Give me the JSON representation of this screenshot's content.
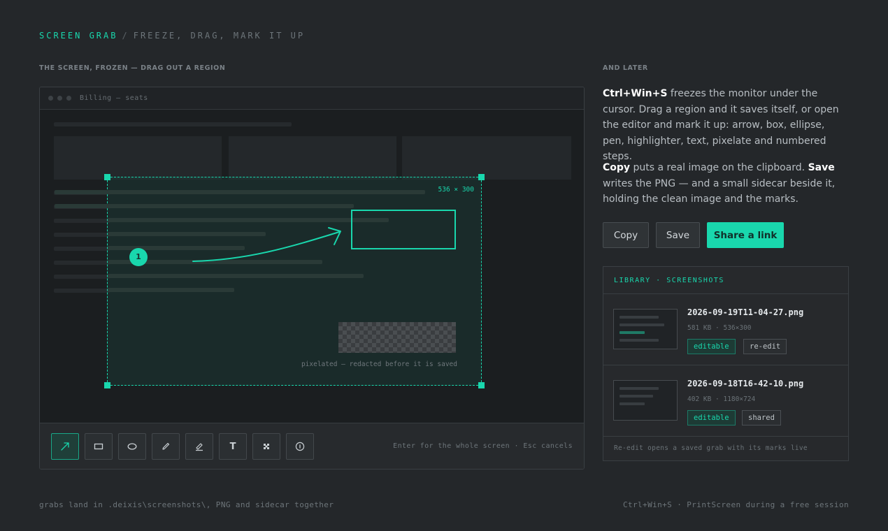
{
  "header": {
    "brand": "SCREEN GRAB",
    "separator": "/",
    "tagline": "FREEZE, DRAG, MARK IT UP"
  },
  "left": {
    "section_label": "THE SCREEN, FROZEN — DRAG OUT A REGION",
    "window_title": "Billing — seats",
    "selection_dims": "536 × 300",
    "step_number": "1",
    "pixelate_label": "pixelated — redacted before it is saved",
    "tools": [
      {
        "name": "arrow-tool",
        "icon": "arrow-icon",
        "active": true
      },
      {
        "name": "box-tool",
        "icon": "rectangle-icon",
        "active": false
      },
      {
        "name": "ellipse-tool",
        "icon": "ellipse-icon",
        "active": false
      },
      {
        "name": "pen-tool",
        "icon": "pen-icon",
        "active": false
      },
      {
        "name": "highlighter-tool",
        "icon": "highlighter-icon",
        "active": false
      },
      {
        "name": "text-tool",
        "icon": "text-icon",
        "label": "T",
        "active": false
      },
      {
        "name": "pixelate-tool",
        "icon": "pixelate-icon",
        "active": false
      },
      {
        "name": "step-tool",
        "icon": "numbered-step-icon",
        "active": false
      }
    ],
    "toolbar_hint": "Enter for the whole screen · Esc cancels"
  },
  "right": {
    "section_label": "AND LATER",
    "para1": {
      "strong": "Ctrl+Win+S",
      "text": " freezes the monitor under the cursor. Drag a region and it saves itself, or open the editor and mark it up: arrow, box, ellipse, pen, highlighter, text, pixelate and numbered steps."
    },
    "para2": {
      "strong1": "Copy",
      "text1": " puts a real image on the clipboard. ",
      "strong2": "Save",
      "text2": " writes the PNG — and a small sidecar beside it, holding the clean image and the marks."
    },
    "buttons": {
      "copy": "Copy",
      "save": "Save",
      "share": "Share a link"
    },
    "library": {
      "title": "LIBRARY · SCREENSHOTS",
      "items": [
        {
          "filename": "2026-09-19T11-04-27.png",
          "meta": "581 KB · 536×300",
          "tag1": "editable",
          "tag2": "re-edit"
        },
        {
          "filename": "2026-09-18T16-42-10.png",
          "meta": "402 KB · 1180×724",
          "tag1": "editable",
          "tag2": "shared"
        }
      ],
      "footnote": "Re-edit opens a saved grab with its marks live"
    }
  },
  "footer": {
    "left": "grabs land in .deixis\\screenshots\\, PNG and sidecar together",
    "right": "Ctrl+Win+S · PrintScreen during a free session"
  },
  "colors": {
    "accent": "#19d7ad",
    "background": "#24272a"
  }
}
